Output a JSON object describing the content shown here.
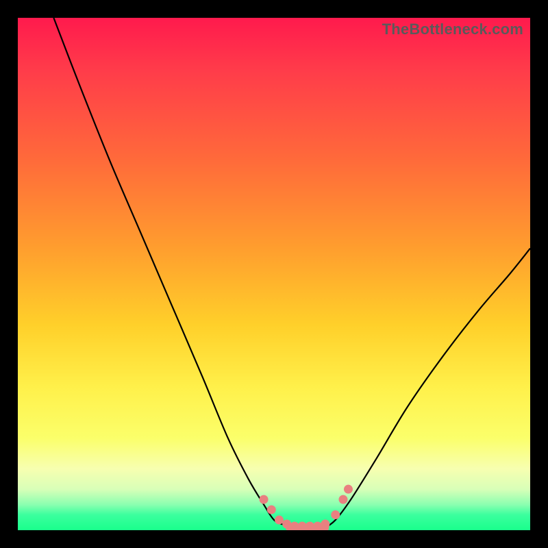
{
  "watermark": "TheBottleneck.com",
  "chart_data": {
    "type": "line",
    "title": "",
    "xlabel": "",
    "ylabel": "",
    "xlim": [
      0,
      100
    ],
    "ylim": [
      0,
      100
    ],
    "grid": false,
    "legend": false,
    "series": [
      {
        "name": "left-curve",
        "x": [
          7,
          12,
          18,
          24,
          30,
          36,
          41,
          45,
          48,
          50,
          52,
          53
        ],
        "y": [
          100,
          87,
          72,
          58,
          44,
          30,
          18,
          10,
          5,
          2,
          1,
          0.5
        ]
      },
      {
        "name": "right-curve",
        "x": [
          60,
          62,
          65,
          70,
          76,
          83,
          90,
          96,
          100
        ],
        "y": [
          0.5,
          2,
          6,
          14,
          24,
          34,
          43,
          50,
          55
        ]
      },
      {
        "name": "flat-bottom",
        "x": [
          53,
          60
        ],
        "y": [
          0.5,
          0.5
        ]
      }
    ],
    "markers": {
      "name": "trough-dots",
      "points": [
        {
          "x": 48,
          "y": 6
        },
        {
          "x": 49.5,
          "y": 4
        },
        {
          "x": 51,
          "y": 2
        },
        {
          "x": 52.5,
          "y": 1.2
        },
        {
          "x": 54,
          "y": 0.8
        },
        {
          "x": 55.5,
          "y": 0.8
        },
        {
          "x": 57,
          "y": 0.8
        },
        {
          "x": 58.5,
          "y": 0.8
        },
        {
          "x": 60,
          "y": 1.2
        },
        {
          "x": 62,
          "y": 3
        },
        {
          "x": 63.5,
          "y": 6
        },
        {
          "x": 64.5,
          "y": 8
        }
      ]
    },
    "gradient_stops": [
      {
        "pct": 0,
        "color": "#ff1a4d"
      },
      {
        "pct": 45,
        "color": "#ff9e2e"
      },
      {
        "pct": 72,
        "color": "#fff04a"
      },
      {
        "pct": 92,
        "color": "#d8ffb8"
      },
      {
        "pct": 100,
        "color": "#1aff8c"
      }
    ]
  }
}
